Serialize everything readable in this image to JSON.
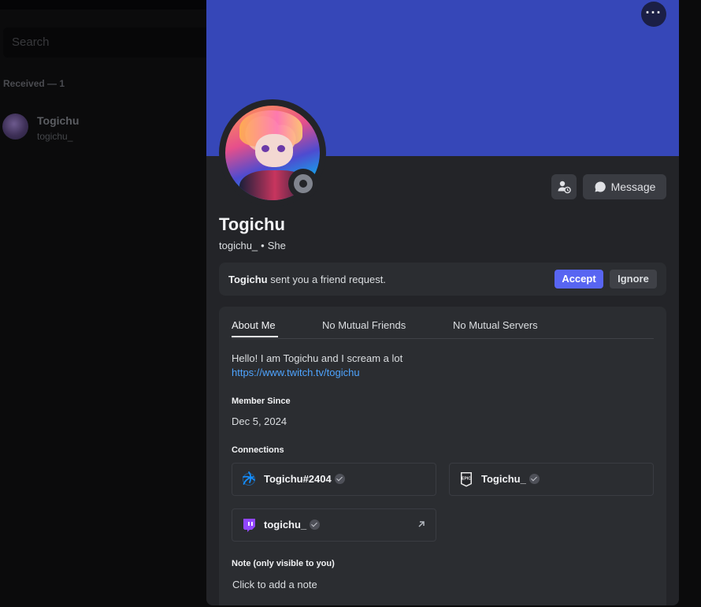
{
  "background": {
    "search_placeholder": "Search",
    "received_header": "Received — 1",
    "friend": {
      "name": "Togichu",
      "username": "togichu_"
    }
  },
  "profile": {
    "more_icon": "more-horizontal-icon",
    "display_name": "Togichu",
    "username": "togichu_",
    "separator": "•",
    "pronouns": "She",
    "status": "offline",
    "banner_color": "#3647b8",
    "message_button": "Message",
    "add_friend_icon": "add-friend-pending-icon"
  },
  "friend_request": {
    "sender": "Togichu",
    "text": "sent you a friend request.",
    "accept": "Accept",
    "ignore": "Ignore"
  },
  "tabs": [
    {
      "label": "About Me",
      "active": true
    },
    {
      "label": "No Mutual Friends",
      "active": false
    },
    {
      "label": "No Mutual Servers",
      "active": false
    }
  ],
  "about": {
    "bio": "Hello! I am Togichu and I scream a lot",
    "link": "https://www.twitch.tv/togichu"
  },
  "member_since": {
    "label": "Member Since",
    "date": "Dec 5, 2024"
  },
  "connections": {
    "label": "Connections",
    "items": [
      {
        "platform": "battle.net",
        "icon": "battlenet-icon",
        "name": "Togichu#2404",
        "verified": true
      },
      {
        "platform": "epic-games",
        "icon": "epic-games-icon",
        "name": "Togichu_",
        "verified": true
      },
      {
        "platform": "twitch",
        "icon": "twitch-icon",
        "name": "togichu_",
        "verified": true,
        "external": true
      }
    ]
  },
  "note": {
    "label": "Note (only visible to you)",
    "placeholder": "Click to add a note"
  },
  "colors": {
    "accent": "#5865f2",
    "link": "#4ea4ff",
    "twitch": "#9146ff",
    "battlenet": "#148eff"
  }
}
